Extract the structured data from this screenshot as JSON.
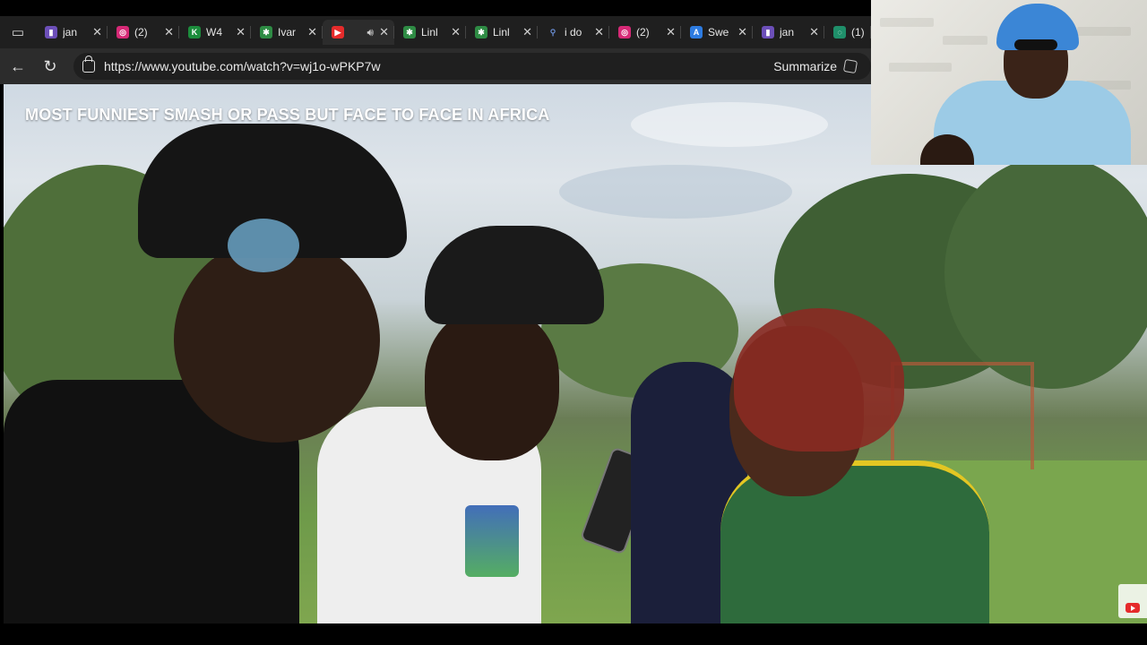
{
  "browser": {
    "tabs": [
      {
        "title": "jan",
        "icon": "twitch-icon",
        "color": "#6c4fb8",
        "active": false
      },
      {
        "title": "(2)",
        "icon": "instagram-icon",
        "color": "#d62976",
        "active": false
      },
      {
        "title": "W4",
        "icon": "kick-icon",
        "color": "#1c8c3c",
        "active": false
      },
      {
        "title": "Ivar",
        "icon": "linktree-icon",
        "color": "#2e8b44",
        "active": false
      },
      {
        "title": "",
        "icon": "youtube-icon",
        "color": "#e52b2b",
        "active": true
      },
      {
        "title": "Linl",
        "icon": "linktree-icon",
        "color": "#2e8b44",
        "active": false
      },
      {
        "title": "Linl",
        "icon": "linktree-icon",
        "color": "#2e8b44",
        "active": false
      },
      {
        "title": "i do",
        "icon": "search-icon",
        "color": "#3b5ea8",
        "active": false
      },
      {
        "title": "(2)",
        "icon": "instagram-icon",
        "color": "#d62976",
        "active": false
      },
      {
        "title": "Swe",
        "icon": "app-store-icon",
        "color": "#2d7be0",
        "active": false
      },
      {
        "title": "jan",
        "icon": "twitch-icon",
        "color": "#6c4fb8",
        "active": false
      },
      {
        "title": "(1)",
        "icon": "chatgpt-icon",
        "color": "#1f8f6a",
        "active": false
      }
    ],
    "url": "https://www.youtube.com/watch?v=wj1o-wPKP7w",
    "summarize_label": "Summarize"
  },
  "video": {
    "title": "MOST FUNNIEST SMASH OR PASS BUT FACE TO FACE IN AFRICA"
  }
}
